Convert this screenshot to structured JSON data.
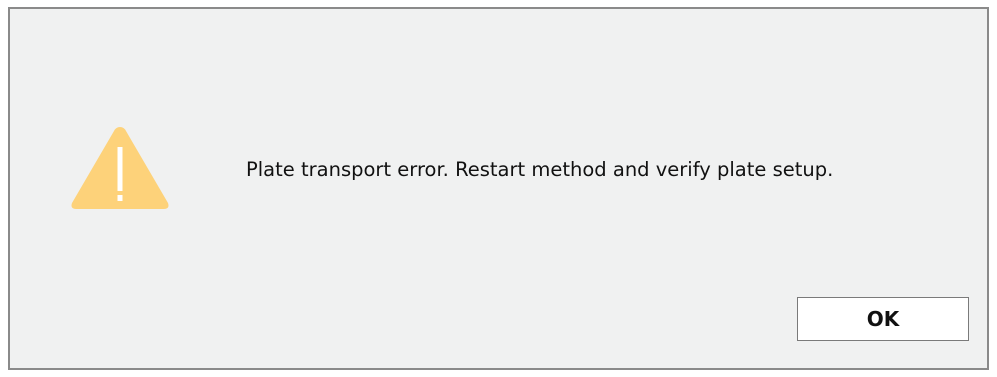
{
  "dialog": {
    "icon": "warning-icon",
    "icon_color": "#fdd27a",
    "message": "Plate transport error. Restart method and verify plate setup.",
    "ok_label": "OK"
  }
}
